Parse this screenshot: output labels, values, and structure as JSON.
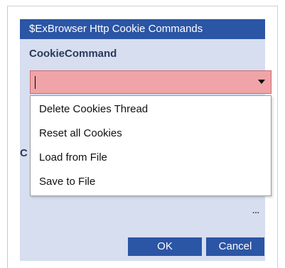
{
  "dialog": {
    "title": "$ExBrowser Http Cookie Commands",
    "field_label": "CookieCommand",
    "hidden_label": "C",
    "combo": {
      "value": "",
      "state_color": "#f0a4a8"
    },
    "dropdown_items": [
      "Delete Cookies Thread",
      "Reset all Cookies",
      "Load from File",
      "Save to File"
    ],
    "ellipsis": "...",
    "buttons": {
      "ok": "OK",
      "cancel": "Cancel"
    }
  },
  "colors": {
    "title_bar": "#2b55a5",
    "dialog_bg": "#d6def0",
    "invalid_field": "#f0a4a8"
  },
  "icons": {
    "combo_arrow": "chevron-down-icon"
  }
}
